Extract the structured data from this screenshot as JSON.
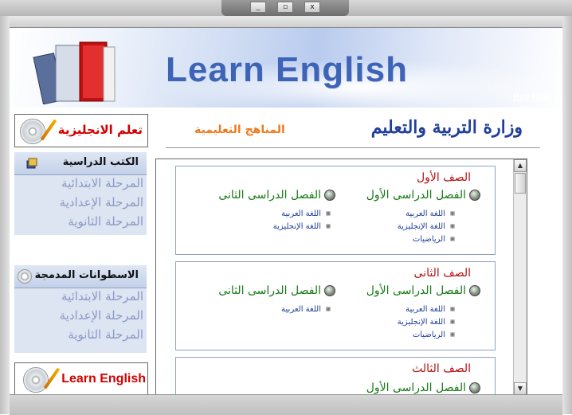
{
  "window": {
    "minimize_label": "_",
    "restore_label": "▫",
    "close_label": "x"
  },
  "banner": {
    "title": "Learn English",
    "buy_now": "Buy Now"
  },
  "ministry": {
    "name": "وزارة التربية والتعليم",
    "subtitle": "المناهج التعليمية"
  },
  "sidebar": {
    "logo_text": "تعلم الانجليزية",
    "books": {
      "heading": "الكتب الدراسية",
      "items": [
        {
          "label": "المرحلة الابتدائية"
        },
        {
          "label": "المرحلة الإعدادية"
        },
        {
          "label": "المرحلة الثانوية"
        }
      ]
    },
    "cds": {
      "heading": "الاسطوانات المدمجة",
      "items": [
        {
          "label": "المرحلة الابتدائية"
        },
        {
          "label": "المرحلة الإعدادية"
        },
        {
          "label": "المرحلة الثانوية"
        }
      ]
    },
    "bottom_logo_text": "Learn English"
  },
  "grades": [
    {
      "title": "الصف الأول",
      "term1": "الفصل الدراسى الأول",
      "term2": "الفصل الدراسى  الثانى",
      "term1_subjects": [
        "اللغة العربية",
        "اللغة الإنجليزية",
        "الرياضيات"
      ],
      "term2_subjects": [
        "اللغة العربية",
        "اللغة الإنجليزية"
      ]
    },
    {
      "title": "الصف الثانى",
      "term1": "الفصل الدراسى الأول",
      "term2": "الفصل الدراسى  الثانى",
      "term1_subjects": [
        "اللغة العربية",
        "اللغة الإنجليزية",
        "الرياضيات"
      ],
      "term2_subjects": [
        "اللغة العربية"
      ]
    },
    {
      "title": "الصف الثالث",
      "term1": "الفصل الدراسى الأول"
    }
  ],
  "colors": {
    "brand_blue": "#3e64b8",
    "ministry_blue": "#1f3f9a",
    "orange": "#f07a1e",
    "red": "#d40000",
    "green": "#157a15"
  }
}
